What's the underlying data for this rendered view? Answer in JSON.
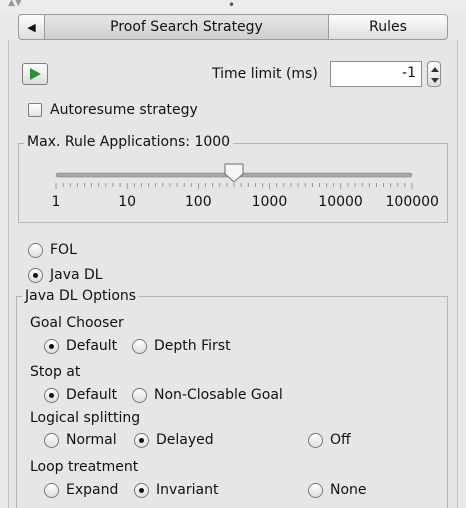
{
  "tabs": [
    {
      "label": "Proof Search Strategy",
      "active": true
    },
    {
      "label": "Rules",
      "active": false
    }
  ],
  "tab_back_icon": "triangle-left-icon",
  "run_icon": "play-icon",
  "time_limit": {
    "label": "Time limit (ms)",
    "value": "-1"
  },
  "autoresume": {
    "label": "Autoresume strategy",
    "checked": false
  },
  "max_rule": {
    "title": "Max. Rule Applications: 1000",
    "slider_level_fraction": 0.5,
    "ticks": [
      "1",
      "10",
      "100",
      "1000",
      "10000",
      "100000"
    ]
  },
  "logic": {
    "options": [
      {
        "label": "FOL",
        "selected": false
      },
      {
        "label": "Java DL",
        "selected": true
      }
    ]
  },
  "javadl": {
    "title": "Java DL Options",
    "sections": [
      {
        "name": "Goal Chooser",
        "options": [
          {
            "label": "Default",
            "selected": true
          },
          {
            "label": "Depth First",
            "selected": false
          }
        ]
      },
      {
        "name": "Stop at",
        "options": [
          {
            "label": "Default",
            "selected": true
          },
          {
            "label": "Non-Closable Goal",
            "selected": false
          }
        ]
      },
      {
        "name": "Logical splitting",
        "options": [
          {
            "label": "Normal",
            "selected": false
          },
          {
            "label": "Delayed",
            "selected": true
          },
          {
            "label": "Off",
            "selected": false
          }
        ]
      },
      {
        "name": "Loop treatment",
        "options": [
          {
            "label": "Expand",
            "selected": false
          },
          {
            "label": "Invariant",
            "selected": true
          },
          {
            "label": "None",
            "selected": false
          }
        ]
      }
    ]
  },
  "colors": {
    "play_green": "#1e9b2a",
    "panel_bg": "#e6e6e6"
  }
}
